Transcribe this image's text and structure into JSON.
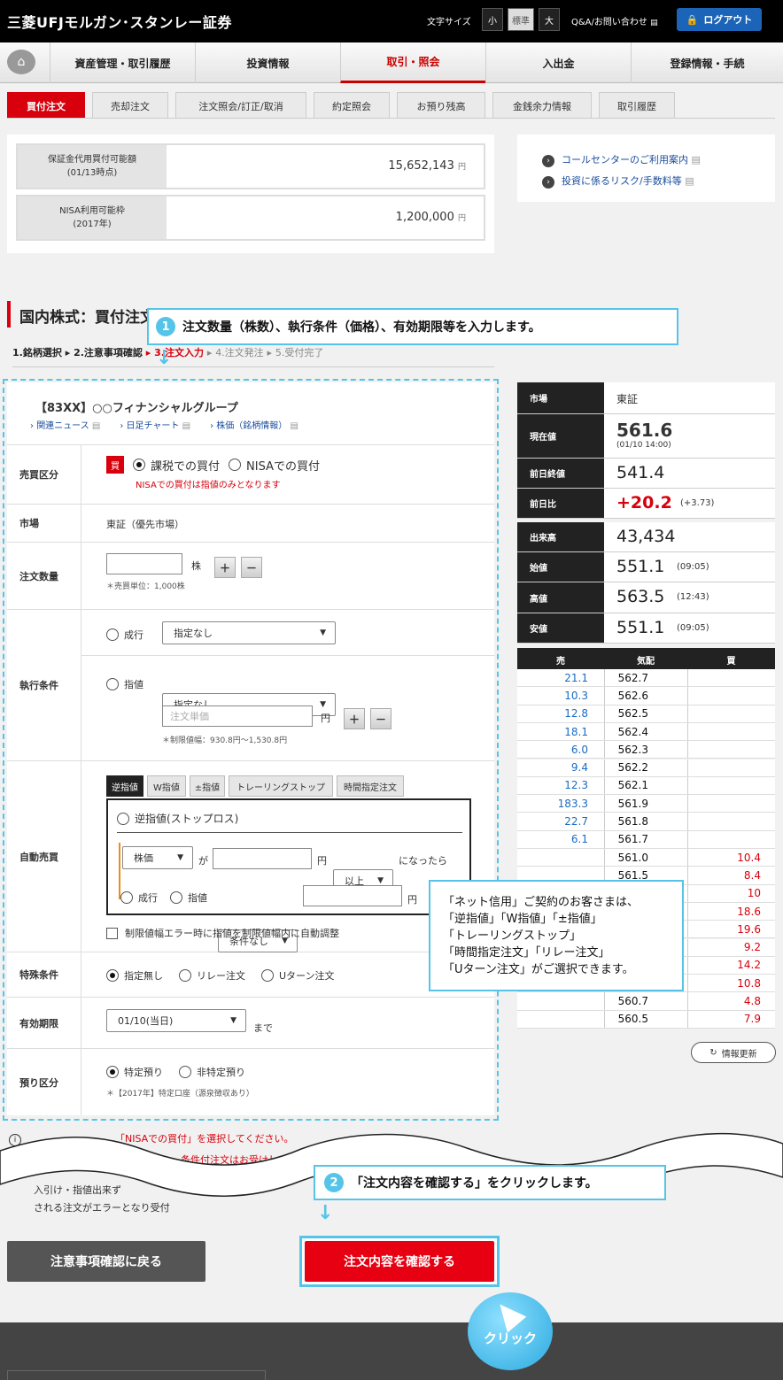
{
  "header": {
    "logo": "三菱UFJモルガン･スタンレー証券",
    "font_size_label": "文字サイズ",
    "font_small": "小",
    "font_standard": "標準",
    "font_large": "大",
    "qa": "Q&A/お問い合わせ",
    "logout": "ログアウト"
  },
  "nav": [
    "資産管理・取引履歴",
    "投資情報",
    "取引・照会",
    "入出金",
    "登録情報・手続"
  ],
  "subtabs": [
    "買付注文",
    "売却注文",
    "注文照会/訂正/取消",
    "約定照会",
    "お預り残高",
    "金銭余力情報",
    "取引履歴"
  ],
  "balance": {
    "margin_label1": "保証金代用買付可能額",
    "margin_label2": "(01/13時点)",
    "margin_value": "15,652,143",
    "nisa_label1": "NISA利用可能枠",
    "nisa_label2": "(2017年)",
    "nisa_value": "1,200,000",
    "yen": "円"
  },
  "links": [
    "コールセンターのご利用案内",
    "投資に係るリスク/手数料等"
  ],
  "heading": "国内株式：買付注文",
  "steps": {
    "s1": "1.銘柄選択",
    "s2": "2.注意事項確認",
    "s3": "3.注文入力",
    "s4": "4.注文発注",
    "s5": "5.受付完了",
    "sep": "▸"
  },
  "callout1": {
    "num": "1",
    "text": "注文数量（株数）、執行条件（価格）、有効期限等を入力します。"
  },
  "callout2": {
    "num": "2",
    "text": "「注文内容を確認する」をクリックします。"
  },
  "callout3": [
    "「ネット信用」ご契約のお客さまは、",
    "「逆指値」「W指値」「±指値」",
    "「トレーリングストップ」",
    "「時間指定注文」「リレー注文」",
    "「Uターン注文」がご選択できます。"
  ],
  "stock": {
    "name": "【83XX】○○フィナンシャルグループ",
    "link1": "関連ニュース",
    "link2": "日足チャート",
    "link3": "株価（銘柄情報）"
  },
  "form": {
    "side_label": "売買区分",
    "buy_badge": "買",
    "opt_taxable": "課税での買付",
    "opt_nisa": "NISAでの買付",
    "nisa_note": "NISAでの買付は指値のみとなります",
    "market_label": "市場",
    "market_value": "東証（優先市場）",
    "qty_label": "注文数量",
    "qty_unit": "株",
    "qty_note": "＊売買単位：1,000株",
    "plus": "＋",
    "minus": "－",
    "exec_label": "執行条件",
    "market_order": "成行",
    "limit_order": "指値",
    "select_none": "指定なし",
    "price_placeholder": "注文単価",
    "yen": "円",
    "range_note": "＊制限値幅：930.8円～1,530.8円",
    "auto_label": "自動売買",
    "auto_tabs": [
      "逆指値",
      "W指値",
      "±指値",
      "トレーリングストップ",
      "時間指定注文"
    ],
    "stop_loss": "逆指値(ストップロス)",
    "stock_price": "株価",
    "ga": "が",
    "above": "以上",
    "became": "になったら",
    "no_cond": "条件なし",
    "auto_adjust": "制限値幅エラー時に指値を制限値幅内に自動調整",
    "special_label": "特殊条件",
    "sp_none": "指定無し",
    "sp_relay": "リレー注文",
    "sp_uturn": "Uターン注文",
    "expiry_label": "有効期限",
    "expiry_value": "01/10(当日)",
    "made": "まで",
    "account_label": "預り区分",
    "acc_specific": "特定預り",
    "acc_nonspecific": "非特定預り",
    "acc_note": "＊【2017年】特定口座（源泉徴収あり）"
  },
  "quote": {
    "market_label": "市場",
    "market_value": "東証",
    "current_label": "現在値",
    "current_value": "561.6",
    "current_time": "(01/10 14:00)",
    "prev_label": "前日終値",
    "prev_value": "541.4",
    "change_label": "前日比",
    "change_value": "+20.2",
    "change_pct": "(+3.73)",
    "volume_label": "出来高",
    "volume_value": "43,434",
    "open_label": "始値",
    "open_value": "551.1",
    "open_time": "(09:05)",
    "high_label": "高値",
    "high_value": "563.5",
    "high_time": "(12:43)",
    "low_label": "安値",
    "low_value": "551.1",
    "low_time": "(09:05)"
  },
  "orderbook": {
    "headers": [
      "売",
      "気配",
      "買"
    ],
    "rows": [
      [
        "21.1",
        "562.7",
        ""
      ],
      [
        "10.3",
        "562.6",
        ""
      ],
      [
        "12.8",
        "562.5",
        ""
      ],
      [
        "18.1",
        "562.4",
        ""
      ],
      [
        "6.0",
        "562.3",
        ""
      ],
      [
        "9.4",
        "562.2",
        ""
      ],
      [
        "12.3",
        "562.1",
        ""
      ],
      [
        "183.3",
        "561.9",
        ""
      ],
      [
        "22.7",
        "561.8",
        ""
      ],
      [
        "6.1",
        "561.7",
        ""
      ],
      [
        "",
        "561.0",
        "10.4"
      ],
      [
        "",
        "561.5",
        "8.4"
      ],
      [
        "",
        "",
        "10"
      ],
      [
        "",
        "",
        "18.6"
      ],
      [
        "",
        "",
        "19.6"
      ],
      [
        "",
        "",
        "9.2"
      ],
      [
        "",
        "",
        "14.2"
      ],
      [
        "",
        "",
        "10.8"
      ],
      [
        "",
        "560.7",
        "4.8"
      ],
      [
        "",
        "560.5",
        "7.9"
      ]
    ]
  },
  "refresh": "情報更新",
  "notes": {
    "n1": "「NISAでの買付」を選択してください。",
    "n2": "条件付注文はお受けして",
    "n3": "入引け・指値出来ず",
    "n4": "される注文がエラーとなり受付"
  },
  "buttons": {
    "back": "注意事項確認に戻る",
    "confirm": "注文内容を確認する",
    "click": "クリック"
  },
  "colors": {
    "accent": "#d8000c",
    "callout": "#56c4e8",
    "blue_link": "#1a4c9c",
    "ask_blue": "#1a6bc4"
  }
}
